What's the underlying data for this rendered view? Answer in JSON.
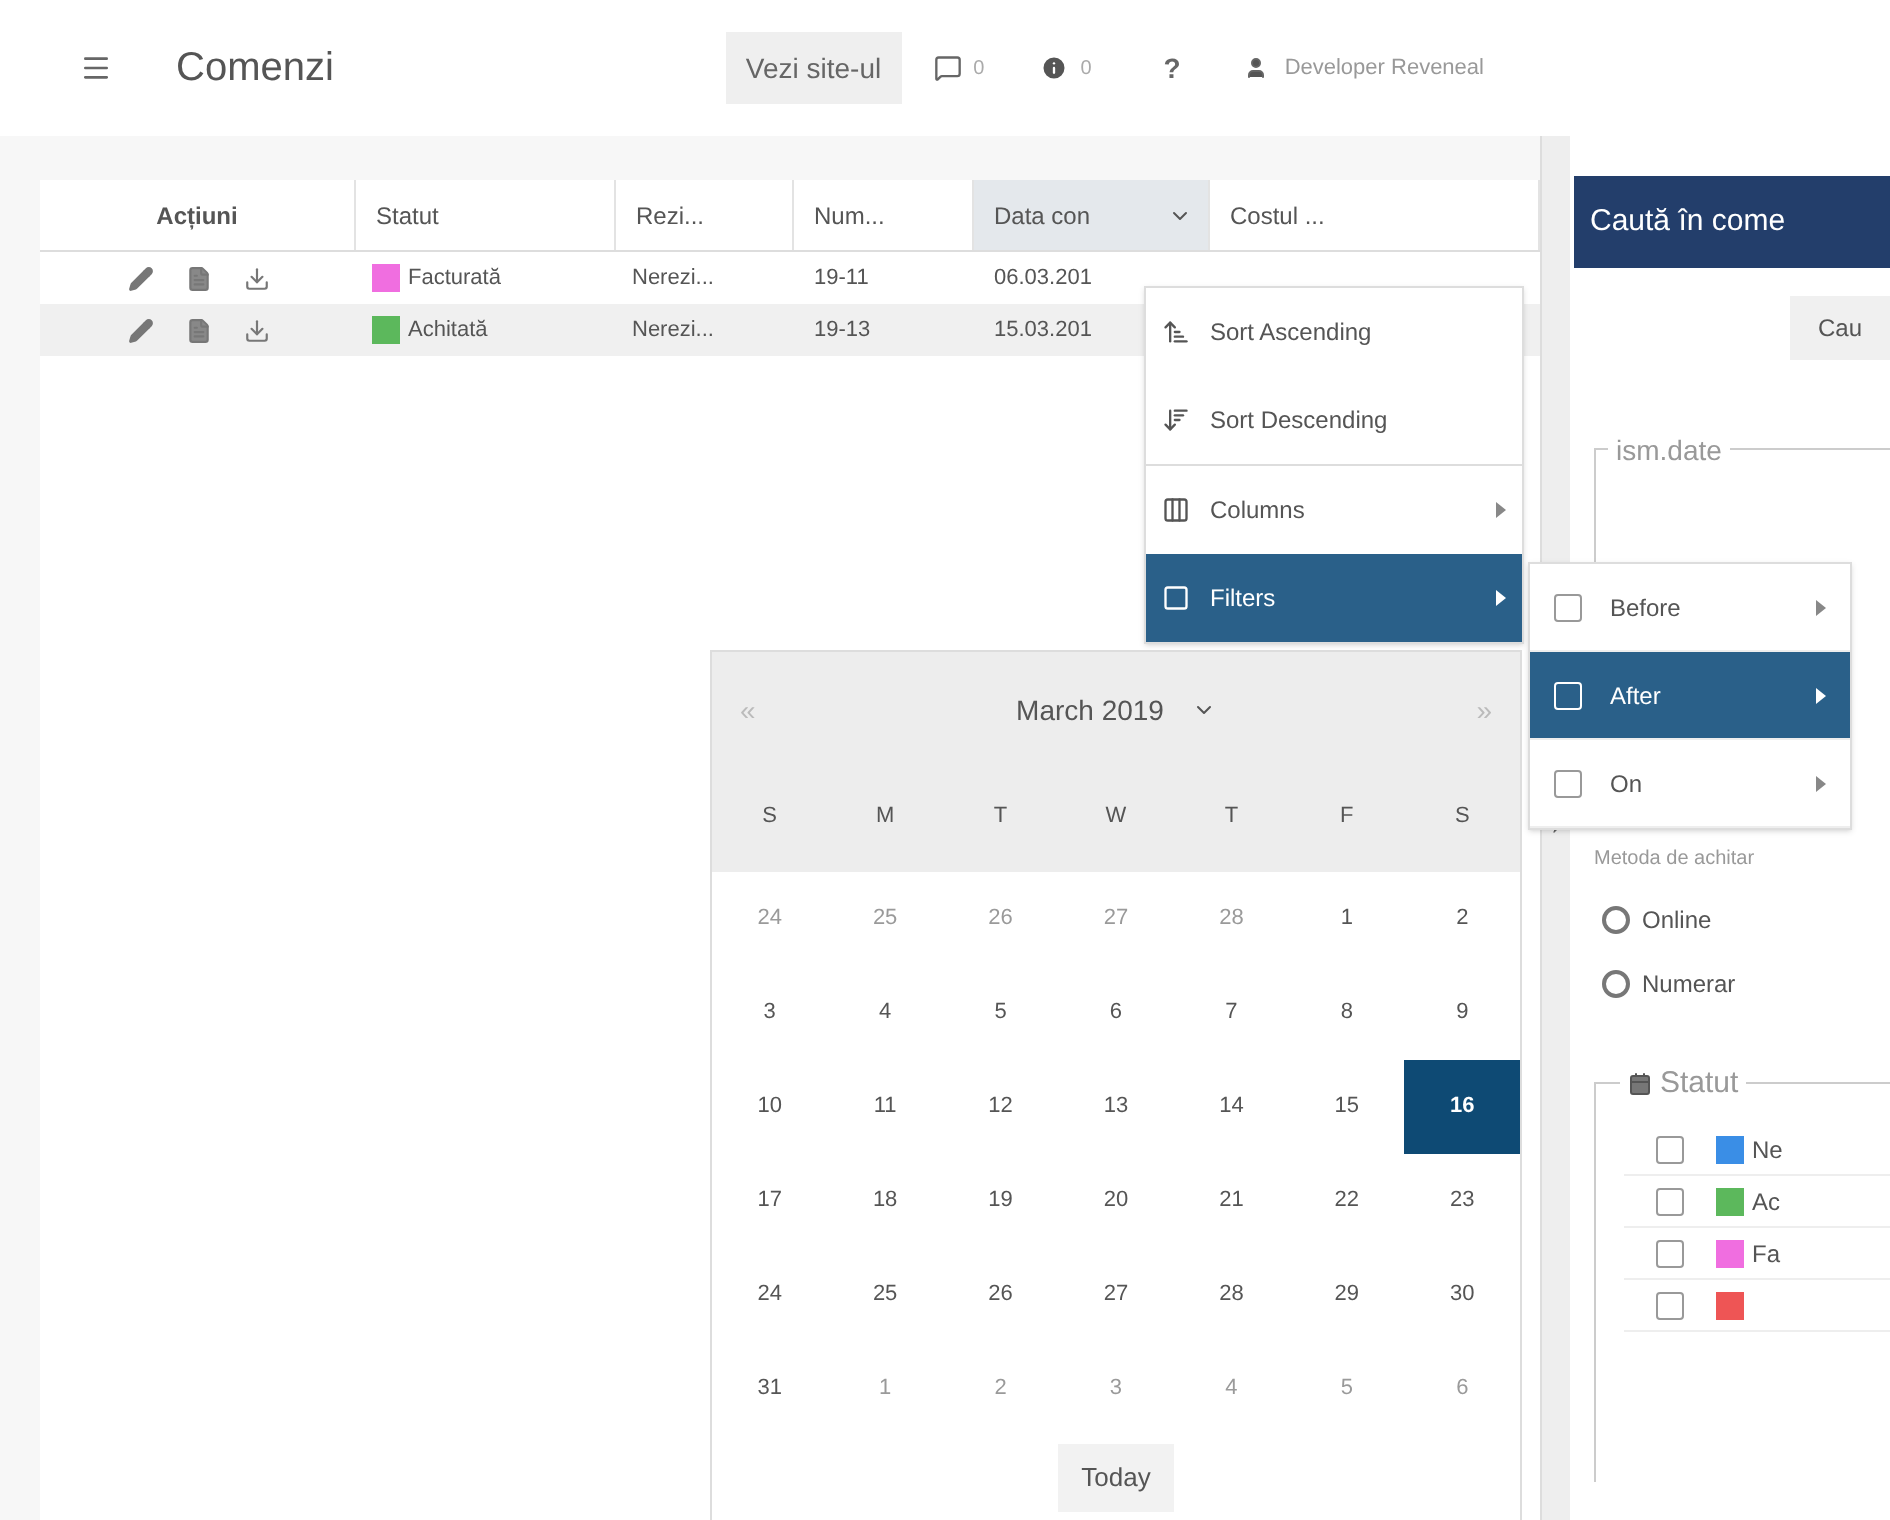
{
  "header": {
    "title": "Comenzi",
    "site_button": "Vezi site-ul",
    "comments_count": "0",
    "alerts_count": "0",
    "help": "?",
    "user": "Developer Reveneal"
  },
  "table": {
    "columns": [
      {
        "label": "Acțiuni",
        "sorted": false
      },
      {
        "label": "Statut",
        "sorted": false
      },
      {
        "label": "Rezi...",
        "sorted": false
      },
      {
        "label": "Num...",
        "sorted": false
      },
      {
        "label": "Data con",
        "sorted": true
      },
      {
        "label": "Costul ...",
        "sorted": false
      }
    ],
    "rows": [
      {
        "status": "Facturată",
        "color": "#f06ee0",
        "column_3": "Nerezi...",
        "number": "19-11",
        "date": "06.03.201",
        "selected": false
      },
      {
        "status": "Achitată",
        "color": "#5cb85c",
        "column_3": "Nerezi...",
        "number": "19-13",
        "date": "15.03.201",
        "selected": true
      }
    ]
  },
  "column_menu": {
    "items": [
      {
        "kind": "sort",
        "label": "Sort Ascending",
        "highlighted": false
      },
      {
        "kind": "sort",
        "label": "Sort Descending",
        "highlighted": false
      },
      {
        "kind": "submenu",
        "label": "Columns",
        "highlighted": false
      },
      {
        "kind": "submenu",
        "label": "Filters",
        "highlighted": true
      }
    ]
  },
  "filter_menu": {
    "items": [
      {
        "label": "Before",
        "selected": false,
        "checked": false
      },
      {
        "label": "After",
        "selected": true,
        "checked": false
      },
      {
        "label": "On",
        "selected": false,
        "checked": false
      }
    ]
  },
  "calendar": {
    "month": "March 2019",
    "prev": "«",
    "next": "»",
    "weekdays": [
      "S",
      "M",
      "T",
      "W",
      "T",
      "F",
      "S"
    ],
    "days": [
      {
        "d": "24",
        "muted": true,
        "selected": false
      },
      {
        "d": "25",
        "muted": true,
        "selected": false
      },
      {
        "d": "26",
        "muted": true,
        "selected": false
      },
      {
        "d": "27",
        "muted": true,
        "selected": false
      },
      {
        "d": "28",
        "muted": true,
        "selected": false
      },
      {
        "d": "1",
        "muted": false,
        "selected": false
      },
      {
        "d": "2",
        "muted": false,
        "selected": false
      },
      {
        "d": "3",
        "muted": false,
        "selected": false
      },
      {
        "d": "4",
        "muted": false,
        "selected": false
      },
      {
        "d": "5",
        "muted": false,
        "selected": false
      },
      {
        "d": "6",
        "muted": false,
        "selected": false
      },
      {
        "d": "7",
        "muted": false,
        "selected": false
      },
      {
        "d": "8",
        "muted": false,
        "selected": false
      },
      {
        "d": "9",
        "muted": false,
        "selected": false
      },
      {
        "d": "10",
        "muted": false,
        "selected": false
      },
      {
        "d": "11",
        "muted": false,
        "selected": false
      },
      {
        "d": "12",
        "muted": false,
        "selected": false
      },
      {
        "d": "13",
        "muted": false,
        "selected": false
      },
      {
        "d": "14",
        "muted": false,
        "selected": false
      },
      {
        "d": "15",
        "muted": false,
        "selected": false
      },
      {
        "d": "16",
        "muted": false,
        "selected": true
      },
      {
        "d": "17",
        "muted": false,
        "selected": false
      },
      {
        "d": "18",
        "muted": false,
        "selected": false
      },
      {
        "d": "19",
        "muted": false,
        "selected": false
      },
      {
        "d": "20",
        "muted": false,
        "selected": false
      },
      {
        "d": "21",
        "muted": false,
        "selected": false
      },
      {
        "d": "22",
        "muted": false,
        "selected": false
      },
      {
        "d": "23",
        "muted": false,
        "selected": false
      },
      {
        "d": "24",
        "muted": false,
        "selected": false
      },
      {
        "d": "25",
        "muted": false,
        "selected": false
      },
      {
        "d": "26",
        "muted": false,
        "selected": false
      },
      {
        "d": "27",
        "muted": false,
        "selected": false
      },
      {
        "d": "28",
        "muted": false,
        "selected": false
      },
      {
        "d": "29",
        "muted": false,
        "selected": false
      },
      {
        "d": "30",
        "muted": false,
        "selected": false
      },
      {
        "d": "31",
        "muted": false,
        "selected": false
      },
      {
        "d": "1",
        "muted": true,
        "selected": false
      },
      {
        "d": "2",
        "muted": true,
        "selected": false
      },
      {
        "d": "3",
        "muted": true,
        "selected": false
      },
      {
        "d": "4",
        "muted": true,
        "selected": false
      },
      {
        "d": "5",
        "muted": true,
        "selected": false
      },
      {
        "d": "6",
        "muted": true,
        "selected": false
      }
    ],
    "today_button": "Today"
  },
  "search_panel": {
    "title": "Caută în come",
    "search_button": "Cau",
    "date_legend": "ism.date",
    "payment_label": "Metoda de achitar",
    "payment_options": [
      {
        "label": "Online",
        "selected": false
      },
      {
        "label": "Numerar",
        "selected": false
      }
    ],
    "status_legend": "Statut",
    "statuses": [
      {
        "label": "Ne",
        "color": "#3a8ee6",
        "checked": false
      },
      {
        "label": "Ac",
        "color": "#5cb85c",
        "checked": false
      },
      {
        "label": "Fa",
        "color": "#f06ee0",
        "checked": false
      },
      {
        "color": "#ee5555",
        "checked": false
      }
    ]
  }
}
